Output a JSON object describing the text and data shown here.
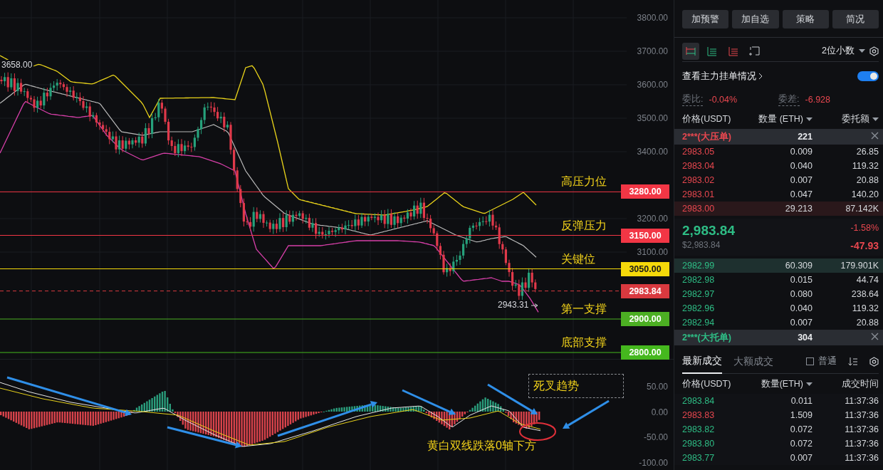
{
  "price_chart": {
    "y_axis": [
      "3800.00",
      "3700.00",
      "3600.00",
      "3500.00",
      "3400.00",
      "3200.00",
      "3100.00"
    ],
    "levels": [
      {
        "kind": "level",
        "label": "高压力位",
        "price": "3280.00",
        "color": "#f23645"
      },
      {
        "kind": "level",
        "label": "反弹压力",
        "price": "3150.00",
        "color": "#f23645"
      },
      {
        "kind": "level",
        "label": "关键位",
        "price": "3050.00",
        "color": "#f5d90a"
      },
      {
        "kind": "current",
        "price": "2983.84",
        "color": "#d9393f"
      },
      {
        "kind": "level",
        "label": "第一支撑",
        "price": "2900.00",
        "color": "#4caf23"
      },
      {
        "kind": "level",
        "label": "底部支撑",
        "price": "2800.00",
        "color": "#45b81e"
      }
    ],
    "high_label": "3658.00",
    "low_label": "2943.31"
  },
  "macd": {
    "y_axis": [
      "50.00",
      "0.00",
      "-50.00",
      "-100.00"
    ],
    "callout": "死叉趋势",
    "note": "黄白双线跌落0轴下方"
  },
  "actions": [
    "加预警",
    "加自选",
    "策略",
    "简况"
  ],
  "view_modes": [
    {
      "kind": "both",
      "selected": true
    },
    {
      "kind": "bids",
      "selected": false
    },
    {
      "kind": "asks",
      "selected": false
    },
    {
      "kind": "custom",
      "selected": false
    }
  ],
  "decimals": "2位小数",
  "main_orders": {
    "label": "查看主力挂单情况",
    "on": true
  },
  "ratio": {
    "label": "委比:",
    "value": "-0.04%"
  },
  "diff": {
    "label": "委差:",
    "value": "-6.928"
  },
  "book_columns": [
    {
      "label": "价格(USDT)",
      "dropdown": false
    },
    {
      "label": "数量 (ETH)",
      "dropdown": true
    },
    {
      "label": "委托额",
      "dropdown": true
    }
  ],
  "ask_banner": {
    "label": "2***(大压单)",
    "value": "221"
  },
  "asks": [
    {
      "price": "2983.05",
      "qty": "0.009",
      "total": "26.85",
      "highlighted": false
    },
    {
      "price": "2983.04",
      "qty": "0.040",
      "total": "119.32",
      "highlighted": false
    },
    {
      "price": "2983.02",
      "qty": "0.007",
      "total": "20.88",
      "highlighted": false
    },
    {
      "price": "2983.01",
      "qty": "0.047",
      "total": "140.20",
      "highlighted": false
    },
    {
      "price": "2983.00",
      "qty": "29.213",
      "total": "87.142K",
      "highlighted": true
    }
  ],
  "last_price": {
    "price": "2,983.84",
    "usd": "$2,983.84",
    "change_pct": "-1.58%",
    "change": "-47.93"
  },
  "bids": [
    {
      "price": "2982.99",
      "qty": "60.309",
      "total": "179.901K",
      "highlighted": true
    },
    {
      "price": "2982.98",
      "qty": "0.015",
      "total": "44.74",
      "highlighted": false
    },
    {
      "price": "2982.97",
      "qty": "0.080",
      "total": "238.64",
      "highlighted": false
    },
    {
      "price": "2982.96",
      "qty": "0.040",
      "total": "119.32",
      "highlighted": false
    },
    {
      "price": "2982.94",
      "qty": "0.007",
      "total": "20.88",
      "highlighted": false
    }
  ],
  "bid_banner": {
    "label": "2***(大托单)",
    "value": "304"
  },
  "trade_tabs": [
    {
      "label": "最新成交",
      "selected": true
    },
    {
      "label": "大额成交",
      "selected": false
    }
  ],
  "filter": {
    "label": "普通",
    "checked": false
  },
  "trade_columns": [
    {
      "label": "价格(USDT)",
      "dropdown": false
    },
    {
      "label": "数量(ETH)",
      "dropdown": true
    },
    {
      "label": "成交时间",
      "dropdown": false
    }
  ],
  "trades": [
    {
      "price": "2983.84",
      "qty": "0.011",
      "time": "11:37:36",
      "color": "#2ebd85"
    },
    {
      "price": "2983.83",
      "qty": "1.509",
      "time": "11:37:36",
      "color": "#e8474f"
    },
    {
      "price": "2983.82",
      "qty": "0.072",
      "time": "11:37:36",
      "color": "#2ebd85"
    },
    {
      "price": "2983.80",
      "qty": "0.072",
      "time": "11:37:36",
      "color": "#2ebd85"
    },
    {
      "price": "2983.77",
      "qty": "0.007",
      "time": "11:37:36",
      "color": "#2ebd85"
    }
  ]
}
